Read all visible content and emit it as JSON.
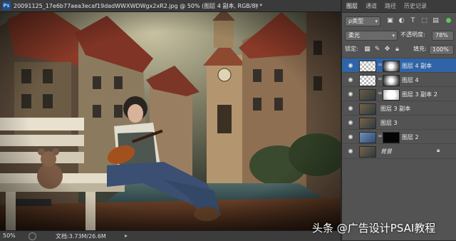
{
  "document": {
    "app_icon": "Ps",
    "tab_title": "20091125_17e6b77aea3ecaf19dadWWXWDWgx2xR2.jpg @ 50% (图层 4 副本, RGB/8) *",
    "close_glyph": "×"
  },
  "status_bar": {
    "zoom": "50%",
    "doc_info": "文档:3.73M/26.6M",
    "arrow": "▸"
  },
  "panel": {
    "tabs": [
      {
        "label": "图层",
        "active": true
      },
      {
        "label": "通道",
        "active": false
      },
      {
        "label": "路径",
        "active": false
      },
      {
        "label": "历史记录",
        "active": false
      }
    ],
    "filter_kind": "ρ类型",
    "blend_mode": "柔光",
    "opacity_label": "不透明度:",
    "opacity_value": "78%",
    "lock_label": "锁定:",
    "fill_label": "填充:",
    "fill_value": "100%",
    "filter_icons": [
      "image-icon",
      "circle-icon",
      "text-icon",
      "shape-icon",
      "smart-object-icon"
    ],
    "lock_icons": [
      "grid-icon",
      "brush-icon",
      "move-icon",
      "lock-icon"
    ],
    "layers": [
      {
        "name": "图层 4 副本",
        "selected": true,
        "thumb": "checker",
        "mask": "dark-vignette",
        "visible": true
      },
      {
        "name": "图层 4",
        "selected": false,
        "thumb": "checker",
        "mask": "dark-vignette",
        "visible": true
      },
      {
        "name": "图层 3 副本 2",
        "selected": false,
        "thumb": "photo",
        "mask": "light",
        "visible": true
      },
      {
        "name": "图层 3 副本",
        "selected": false,
        "thumb": "photo",
        "mask": "",
        "visible": true
      },
      {
        "name": "图层 3",
        "selected": false,
        "thumb": "photo",
        "mask": "",
        "visible": true
      },
      {
        "name": "图层 2",
        "selected": false,
        "thumb": "blue",
        "mask": "black",
        "visible": true
      },
      {
        "name": "背景",
        "selected": false,
        "thumb": "photo",
        "mask": "",
        "visible": true,
        "locked": true
      }
    ]
  },
  "watermark": "头条 @广告设计PSAI教程",
  "colors": {
    "selected_layer": "#2f64a8",
    "panel_bg": "#535353",
    "app_bg": "#282828"
  }
}
